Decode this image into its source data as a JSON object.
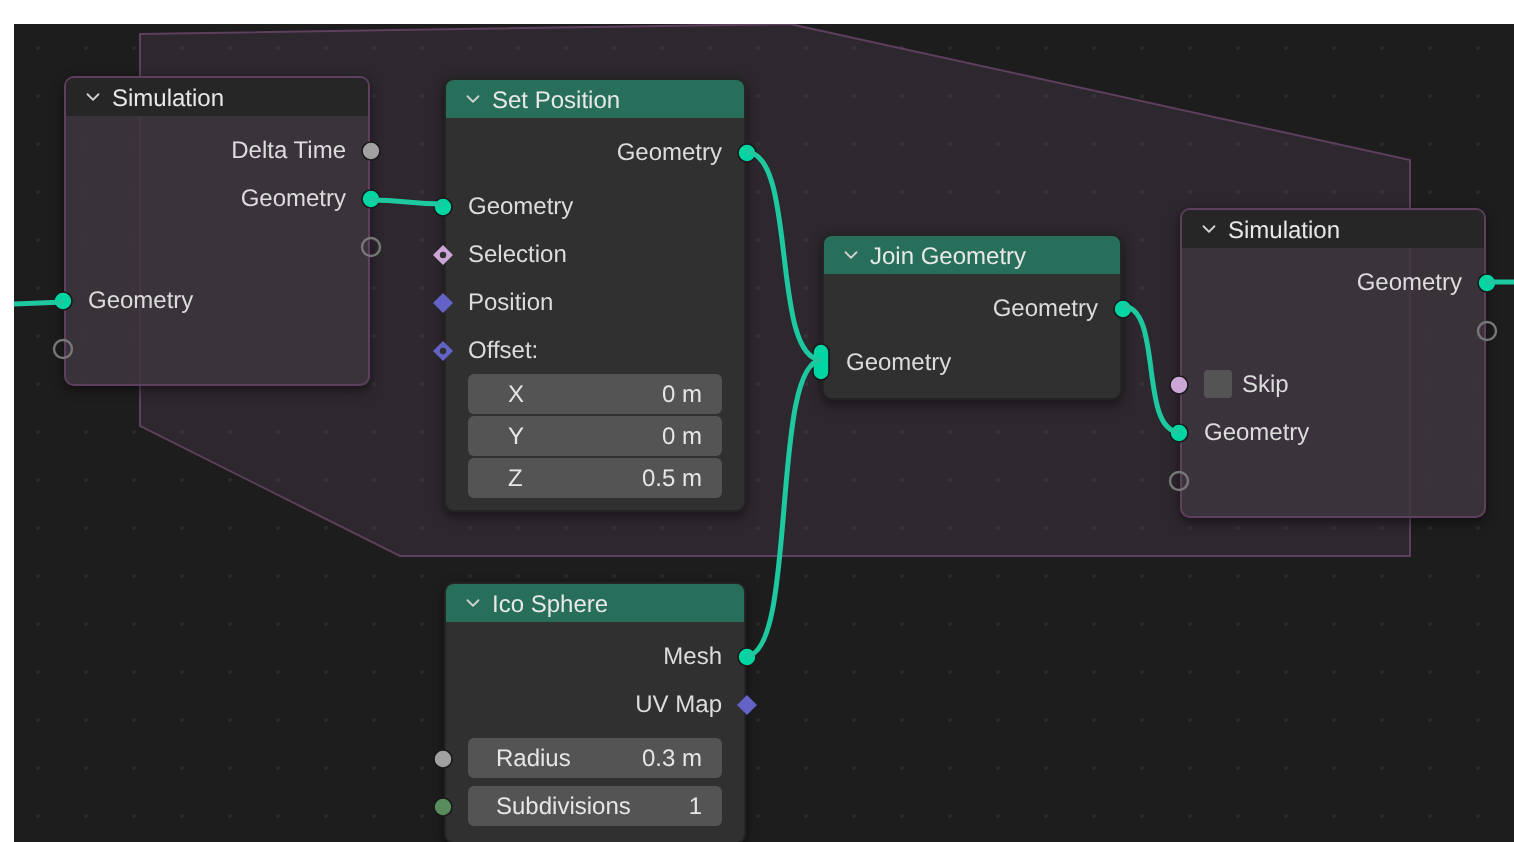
{
  "nodes": [
    {
      "title": "Simulation",
      "kind": "simulation",
      "rows": [
        {
          "kind": "output",
          "label": "Delta Time",
          "socket": {
            "kind": "float"
          }
        },
        {
          "kind": "output",
          "label": "Geometry",
          "socket": {
            "kind": "geometry"
          }
        },
        {
          "kind": "output",
          "socket": {
            "kind": "virtual"
          }
        },
        {
          "kind": "input",
          "label": "Geometry",
          "socket": {
            "kind": "geometry"
          }
        },
        {
          "kind": "input",
          "socket": {
            "kind": "virtual"
          }
        }
      ]
    },
    {
      "title": "Set Position",
      "kind": "geometry",
      "rows": [
        {
          "kind": "output",
          "label": "Geometry",
          "socket": {
            "kind": "geometry"
          }
        },
        {
          "kind": "input",
          "label": "Geometry",
          "socket": {
            "kind": "geometry"
          }
        },
        {
          "kind": "input",
          "label": "Selection",
          "socket": {
            "kind": "boolfield"
          }
        },
        {
          "kind": "input",
          "label": "Position",
          "socket": {
            "kind": "vector"
          }
        },
        {
          "kind": "input",
          "label": "Offset:",
          "socket": {
            "kind": "vectorfield"
          }
        },
        {
          "kind": "vector",
          "values": [
            {
              "label": "X",
              "value": "0 m"
            },
            {
              "label": "Y",
              "value": "0 m"
            },
            {
              "label": "Z",
              "value": "0.5 m"
            }
          ]
        }
      ]
    },
    {
      "title": "Join Geometry",
      "kind": "geometry",
      "rows": [
        {
          "kind": "output",
          "label": "Geometry",
          "socket": {
            "kind": "geometry"
          }
        },
        {
          "kind": "input",
          "label": "Geometry",
          "socket": {
            "kind": "multigeometry"
          }
        }
      ]
    },
    {
      "title": "Simulation",
      "kind": "simulation",
      "rows": [
        {
          "kind": "output",
          "label": "Geometry",
          "socket": {
            "kind": "geometry"
          }
        },
        {
          "kind": "output",
          "socket": {
            "kind": "virtual"
          }
        },
        {
          "kind": "toggle",
          "label": "Skip",
          "checked": false,
          "socket": {
            "kind": "bool"
          }
        },
        {
          "kind": "input",
          "label": "Geometry",
          "socket": {
            "kind": "geometry"
          }
        },
        {
          "kind": "input",
          "socket": {
            "kind": "virtual"
          }
        }
      ]
    },
    {
      "title": "Ico Sphere",
      "kind": "geometry",
      "rows": [
        {
          "kind": "output",
          "label": "Mesh",
          "socket": {
            "kind": "geometry"
          }
        },
        {
          "kind": "output",
          "label": "UV Map",
          "socket": {
            "kind": "vector"
          }
        },
        {
          "kind": "value",
          "label": "Radius",
          "value": "0.3 m",
          "socket": {
            "kind": "float"
          }
        },
        {
          "kind": "value",
          "label": "Subdivisions",
          "value": "1",
          "socket": {
            "kind": "int"
          }
        }
      ]
    }
  ]
}
